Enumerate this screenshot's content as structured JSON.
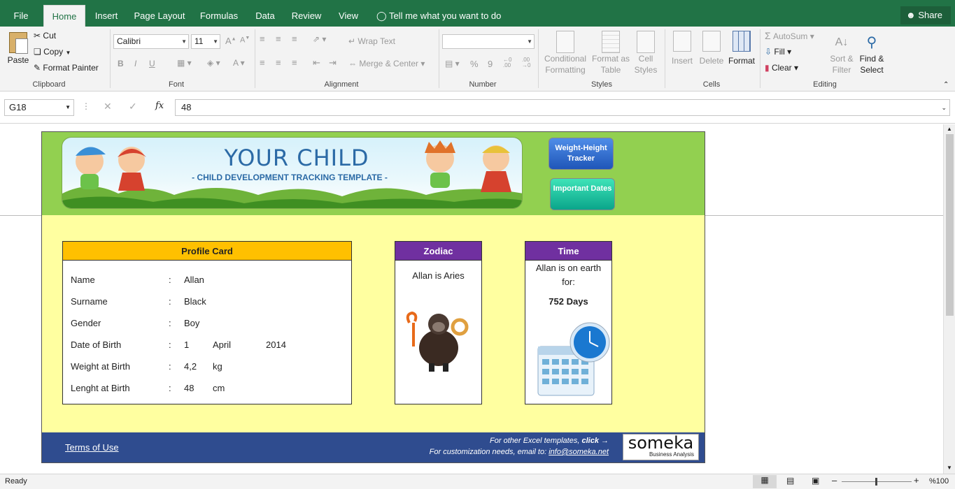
{
  "tabs": [
    "File",
    "Home",
    "Insert",
    "Page Layout",
    "Formulas",
    "Data",
    "Review",
    "View"
  ],
  "tell_me": "Tell me what you want to do",
  "share": "Share",
  "clipboard": {
    "paste": "Paste",
    "cut": "Cut",
    "copy": "Copy",
    "format_painter": "Format Painter",
    "label": "Clipboard"
  },
  "font": {
    "name": "Calibri",
    "size": "11",
    "bold": "B",
    "italic": "I",
    "underline": "U",
    "label": "Font"
  },
  "alignment": {
    "wrap": "Wrap Text",
    "merge": "Merge & Center",
    "label": "Alignment"
  },
  "number": {
    "format": "",
    "percent": "%",
    "comma": "9",
    "label": "Number"
  },
  "styles": {
    "conditional": "Conditional Formatting",
    "format_table": "Format as Table",
    "cell_styles": "Cell Styles",
    "label": "Styles"
  },
  "cells": {
    "insert": "Insert",
    "delete": "Delete",
    "format": "Format",
    "label": "Cells"
  },
  "editing": {
    "autosum": "AutoSum",
    "fill": "Fill",
    "clear": "Clear",
    "sort": "Sort & Filter",
    "find": "Find & Select",
    "label": "Editing"
  },
  "formula_bar": {
    "name_box": "G18",
    "fx": "fx",
    "value": "48"
  },
  "banner": {
    "title": "YOUR CHILD",
    "subtitle": "- CHILD DEVELOPMENT TRACKING TEMPLATE -"
  },
  "nav": {
    "weight": "Weight-Height Tracker",
    "dates": "Important Dates"
  },
  "profile": {
    "title": "Profile Card",
    "rows": [
      {
        "label": "Name",
        "sep": ":",
        "v1": "Allan",
        "v2": "",
        "v3": ""
      },
      {
        "label": "Surname",
        "sep": ":",
        "v1": "Black",
        "v2": "",
        "v3": ""
      },
      {
        "label": "Gender",
        "sep": ":",
        "v1": "Boy",
        "v2": "",
        "v3": ""
      },
      {
        "label": "Date of Birth",
        "sep": ":",
        "v1": "1",
        "v2": "April",
        "v3": "2014"
      },
      {
        "label": "Weight at Birth",
        "sep": ":",
        "v1": "4,2",
        "v2": "kg",
        "v3": ""
      },
      {
        "label": "Lenght at Birth",
        "sep": ":",
        "v1": "48",
        "v2": "cm",
        "v3": ""
      }
    ]
  },
  "zodiac": {
    "title": "Zodiac",
    "text": "Allan is Aries"
  },
  "time": {
    "title": "Time",
    "line1": "Allan is on earth",
    "line2": "for:",
    "days": "752 Days"
  },
  "footer": {
    "terms": "Terms of Use",
    "line1": "For other Excel templates,",
    "click": "click",
    "line2": "For customization needs, email to:",
    "email": "info@someka.net",
    "logo": "someka",
    "logo_sub": "Business Analysis"
  },
  "status": {
    "ready": "Ready",
    "zoom": "%100"
  },
  "colors": {
    "excel_green": "#217346",
    "header_green": "#92d050",
    "body_yellow": "#ffffa0",
    "profile_head": "#ffc000",
    "purple_head": "#7030a0",
    "footer_blue": "#2f4c8f"
  }
}
